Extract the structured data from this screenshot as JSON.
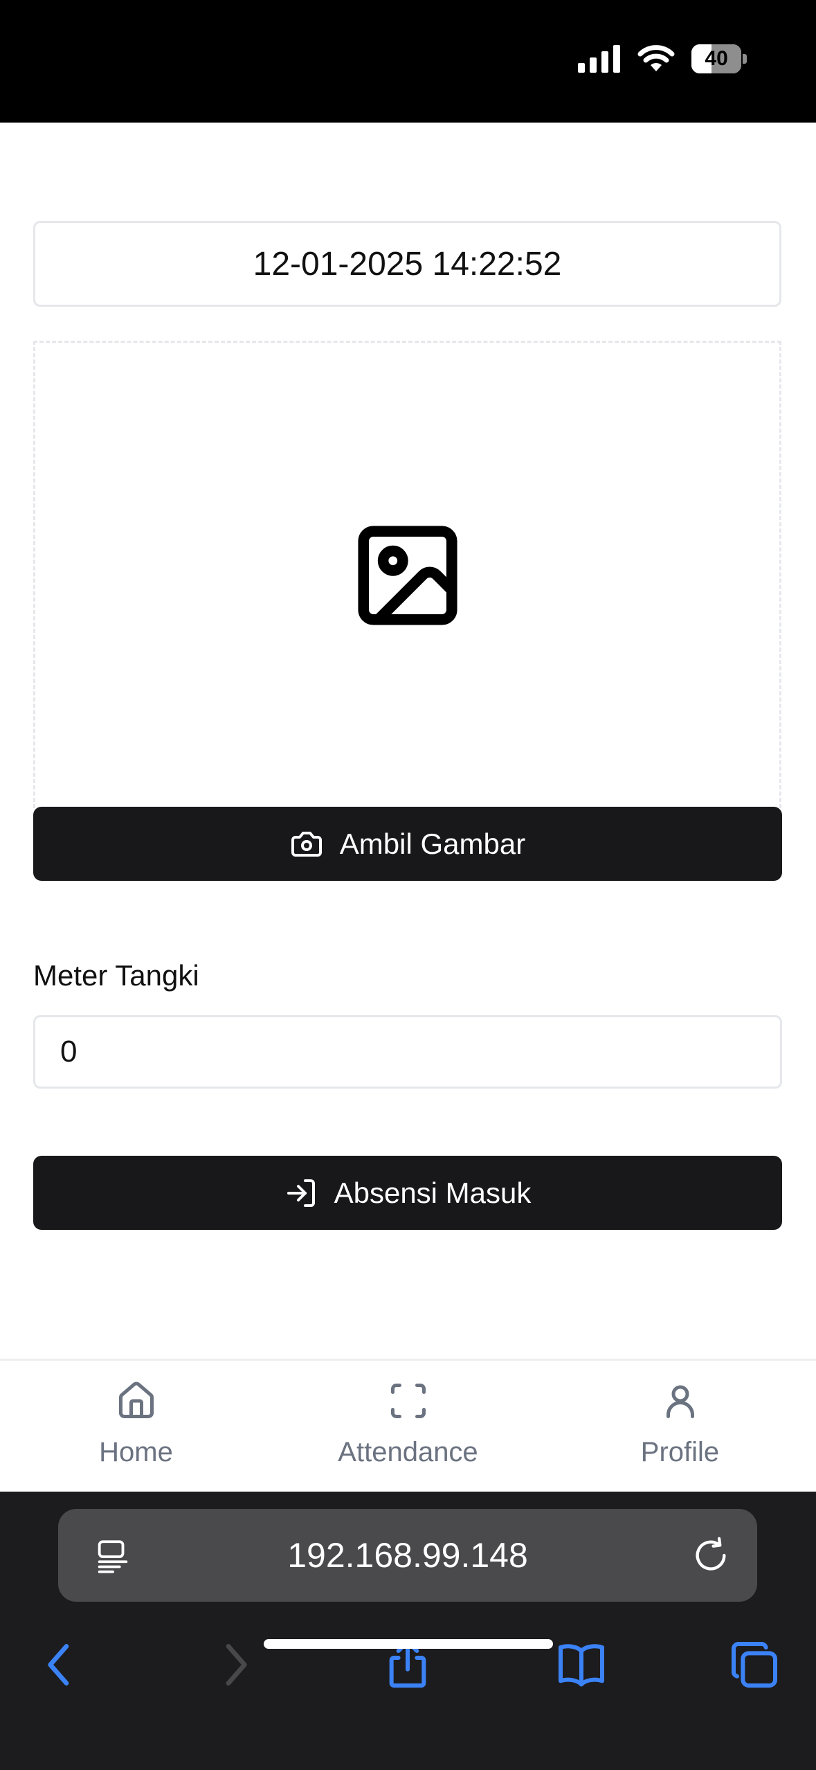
{
  "status_bar": {
    "battery_level": "40"
  },
  "form": {
    "datetime": "12-01-2025 14:22:52",
    "capture_button_label": "Ambil Gambar",
    "meter_label": "Meter Tangki",
    "meter_value": "0",
    "checkin_button_label": "Absensi Masuk"
  },
  "bottom_nav": {
    "items": [
      {
        "label": "Home",
        "icon": "home-icon"
      },
      {
        "label": "Attendance",
        "icon": "scan-frame-icon"
      },
      {
        "label": "Profile",
        "icon": "user-icon"
      }
    ]
  },
  "browser": {
    "url": "192.168.99.148"
  },
  "colors": {
    "button_bg": "#18181b",
    "border": "#e5e7eb",
    "nav_gray": "#6b7280",
    "browser_blue": "#3b82f6"
  }
}
